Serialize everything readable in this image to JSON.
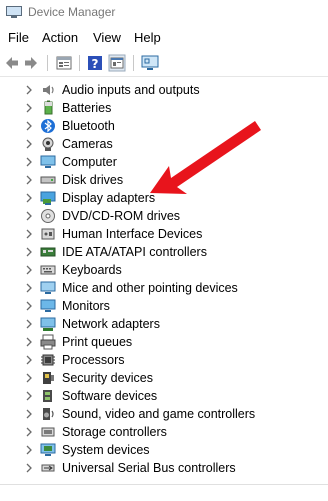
{
  "window": {
    "title": "Device Manager"
  },
  "menu": {
    "file": "File",
    "action": "Action",
    "view": "View",
    "help": "Help"
  },
  "toolbar": {
    "buttons": [
      "back-icon",
      "forward-icon",
      "properties-icon",
      "help-icon",
      "show-hidden-icon",
      "scan-hardware-icon"
    ]
  },
  "tree": {
    "items": [
      {
        "label": "Audio inputs and outputs",
        "icon": "audio-icon"
      },
      {
        "label": "Batteries",
        "icon": "battery-icon"
      },
      {
        "label": "Bluetooth",
        "icon": "bluetooth-icon"
      },
      {
        "label": "Cameras",
        "icon": "camera-icon"
      },
      {
        "label": "Computer",
        "icon": "computer-icon"
      },
      {
        "label": "Disk drives",
        "icon": "disk-drive-icon"
      },
      {
        "label": "Display adapters",
        "icon": "display-adapter-icon"
      },
      {
        "label": "DVD/CD-ROM drives",
        "icon": "dvd-icon"
      },
      {
        "label": "Human Interface Devices",
        "icon": "hid-icon"
      },
      {
        "label": "IDE ATA/ATAPI controllers",
        "icon": "ide-controller-icon"
      },
      {
        "label": "Keyboards",
        "icon": "keyboard-icon"
      },
      {
        "label": "Mice and other pointing devices",
        "icon": "mouse-icon"
      },
      {
        "label": "Monitors",
        "icon": "monitor-icon"
      },
      {
        "label": "Network adapters",
        "icon": "network-icon"
      },
      {
        "label": "Print queues",
        "icon": "printer-icon"
      },
      {
        "label": "Processors",
        "icon": "processor-icon"
      },
      {
        "label": "Security devices",
        "icon": "security-icon"
      },
      {
        "label": "Software devices",
        "icon": "software-device-icon"
      },
      {
        "label": "Sound, video and game controllers",
        "icon": "sound-icon"
      },
      {
        "label": "Storage controllers",
        "icon": "storage-icon"
      },
      {
        "label": "System devices",
        "icon": "system-icon"
      },
      {
        "label": "Universal Serial Bus controllers",
        "icon": "usb-icon"
      }
    ]
  },
  "annotation": {
    "color": "#e8141c",
    "points_to": "Display adapters"
  }
}
